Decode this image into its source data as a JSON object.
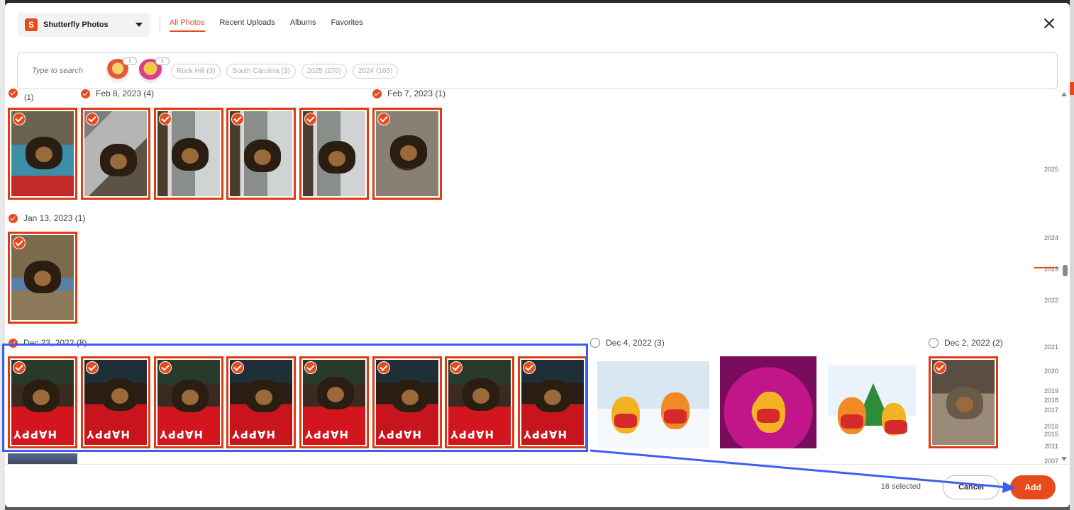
{
  "source": {
    "label": "Shutterfly Photos",
    "logo_letter": "S"
  },
  "tabs": [
    "All Photos",
    "Recent Uploads",
    "Albums",
    "Favorites"
  ],
  "search": {
    "placeholder": "Type to search",
    "face_counts": [
      "1",
      "1"
    ],
    "chips": [
      "Rock Hill (3)",
      "South Carolina (3)",
      "2025 (270)",
      "2024 (165)"
    ]
  },
  "groups": {
    "top_partial": "(1)",
    "feb8": "Feb 8, 2023 (4)",
    "feb7": "Feb 7, 2023 (1)",
    "jan13": "Jan 13, 2023 (1)",
    "dec23": "Dec 23, 2022 (8)",
    "dec4": "Dec 4, 2022 (3)",
    "dec2": "Dec 2, 2022 (2)"
  },
  "timeline": {
    "years": [
      "2025",
      "2024",
      "2023",
      "2022",
      "2021",
      "2020",
      "2019",
      "2018",
      "2017",
      "2016",
      "2015",
      "2011",
      "2007"
    ],
    "current": "2023"
  },
  "footer": {
    "selected": "16 selected",
    "cancel_label": "Cancel",
    "add_label": "Add"
  },
  "colors": {
    "accent": "#e84a1d",
    "annotation": "#3d5ff0"
  }
}
